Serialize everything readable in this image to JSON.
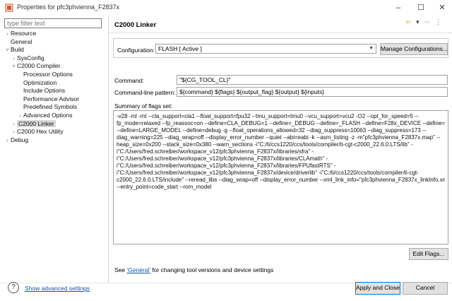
{
  "window": {
    "title": "Properties for pfc3phvienna_F2837x",
    "min": "–",
    "max": "☐",
    "close": "✕"
  },
  "filter": {
    "placeholder": "type filter text"
  },
  "tree": [
    {
      "label": "Resource",
      "arrow": "›",
      "depth": 0
    },
    {
      "label": "General",
      "arrow": "",
      "depth": 0
    },
    {
      "label": "Build",
      "arrow": "˅",
      "depth": 0
    },
    {
      "label": "SysConfig",
      "arrow": "›",
      "depth": 1
    },
    {
      "label": "C2000 Compiler",
      "arrow": "˅",
      "depth": 1
    },
    {
      "label": "Processor Options",
      "arrow": "",
      "depth": 2
    },
    {
      "label": "Optimization",
      "arrow": "",
      "depth": 2
    },
    {
      "label": "Include Options",
      "arrow": "",
      "depth": 2
    },
    {
      "label": "Performance Advisor",
      "arrow": "",
      "depth": 2
    },
    {
      "label": "Predefined Symbols",
      "arrow": "",
      "depth": 2
    },
    {
      "label": "Advanced Options",
      "arrow": "›",
      "depth": 2
    },
    {
      "label": "C2000 Linker",
      "arrow": "›",
      "depth": 1,
      "selected": true
    },
    {
      "label": "C2000 Hex Utility",
      "arrow": "›",
      "depth": 1
    },
    {
      "label": "Debug",
      "arrow": "›",
      "depth": 0
    }
  ],
  "header": {
    "title": "C2000 Linker",
    "back_icon": "⇦",
    "dropdown_icon": "▾",
    "forward_icon": "⇨",
    "menu_icon": "⋮"
  },
  "config": {
    "label": "Configuration:",
    "value": "FLASH  [ Active ]",
    "manage_button": "Manage Configurations..."
  },
  "command": {
    "label": "Command:",
    "value": "\"${CG_TOOL_CL}\""
  },
  "pattern": {
    "label": "Command-line pattern:",
    "value": "${command} ${flags} ${output_flag} ${output} ${inputs}"
  },
  "summary": {
    "label": "Summary of flags set:",
    "lines": [
      "-v28 -ml -mt --cla_support=cla1 --float_support=fpu32 --tmu_support=tmu0 --vcu_support=vcu2 -O2 --opt_for_speed=5 --",
      "fp_mode=relaxed --fp_reassoc=on --define=CLA_DEBUG=1 --define=_DEBUG --define=_FLASH --define=F28x_DEVICE --define=CPU1 --",
      "--define=LARGE_MODEL --define=debug -g --float_operations_allowed=32 --diag_suppress=10063 --diag_suppress=173 --",
      "diag_warning=225 --diag_wrap=off --display_error_number --quiet --abi=eabi -k --asm_listing -z -m\"pfc3phvienna_F2837x.map\" --",
      "heap_size=0x200 --stack_size=0x380 --warn_sections -i\"C:/ti/ccs1220/ccs/tools/compiler/ti-cgt-c2000_22.6.0.LTS/lib\" -",
      "i\"C:/Users/fred.schreiber/workspace_v12/pfc3phvienna_F2837x/libraries/sfra\" -",
      "i\"C:/Users/fred.schreiber/workspace_v12/pfc3phvienna_F2837x/libraries/CLAmath\" -",
      "i\"C:/Users/fred.schreiber/workspace_v12/pfc3phvienna_F2837x/libraries/FPUfastRTS\" -",
      "i\"C:/Users/fred.schreiber/workspace_v12/pfc3phvienna_F2837x/device/driverlib\" -i\"C:/ti/ccs1220/ccs/tools/compiler/ti-cgt-",
      "c2000_22.6.0.LTS/include\" --reread_libs --diag_wrap=off --display_error_number --xml_link_info=\"pfc3phvienna_F2837x_linkInfo.xml\"",
      "--entry_point=code_start --rom_model"
    ],
    "edit_button": "Edit Flags..."
  },
  "see_line": {
    "prefix": "See ",
    "link": "'General'",
    "suffix": " for changing tool versions and device settings"
  },
  "footer": {
    "help_icon": "?",
    "advanced_link": "Show advanced settings",
    "apply_button": "Apply and Close",
    "cancel_button": "Cancel"
  }
}
